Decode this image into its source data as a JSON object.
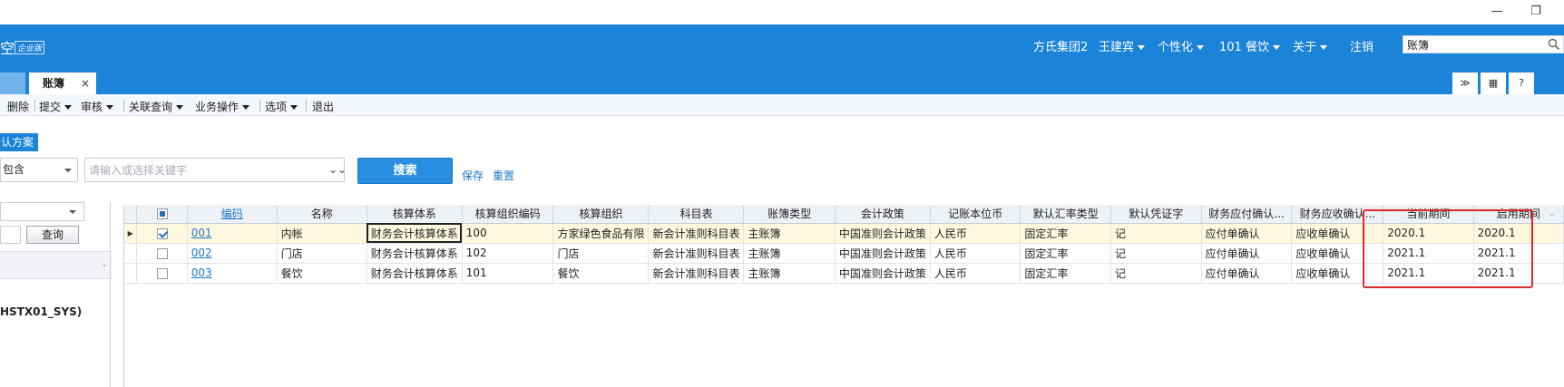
{
  "window": {
    "minimize": "—",
    "restore": "❐"
  },
  "header": {
    "logo_text": "空",
    "edition": "企业版",
    "org": "方氏集团2",
    "user": "王建宾",
    "personalize": "个性化",
    "company": "101  餐饮",
    "about": "关于",
    "logout": "注销",
    "search_value": "账簿"
  },
  "tabs": {
    "active_label": "账簿",
    "close": "×"
  },
  "tab_buttons": [
    "≫",
    "▦",
    "?"
  ],
  "toolbar": {
    "delete": "删除",
    "submit": "提交",
    "audit": "审核",
    "related_query": "关联查询",
    "business_ops": "业务操作",
    "options": "选项",
    "exit": "退出"
  },
  "query": {
    "scheme_label": "认方案",
    "condition_value": "包含",
    "keyword_placeholder": "请输入或选择关键字",
    "expand_icon": "⌄⌄",
    "search_button": "搜索",
    "save_link": "保存",
    "reset_link": "重置"
  },
  "left_panel": {
    "query_button": "查询",
    "node_label": "HSTX01_SYS)"
  },
  "table": {
    "columns": [
      "编码",
      "名称",
      "核算体系",
      "核算组织编码",
      "核算组织",
      "科目表",
      "账簿类型",
      "会计政策",
      "记账本位币",
      "默认汇率类型",
      "默认凭证字",
      "财务应付确认...",
      "财务应收确认...",
      "当前期间",
      "启用期间"
    ],
    "rows": [
      {
        "selected": true,
        "checked": true,
        "cells": [
          "001",
          "内帐",
          "财务会计核算体系",
          "100",
          "方家绿色食品有限",
          "新会计准则科目表",
          "主账簿",
          "中国准则会计政策",
          "人民币",
          "固定汇率",
          "记",
          "应付单确认",
          "应收单确认",
          "2020.1",
          "2020.1"
        ]
      },
      {
        "selected": false,
        "checked": false,
        "cells": [
          "002",
          "门店",
          "财务会计核算体系",
          "102",
          "门店",
          "新会计准则科目表",
          "主账簿",
          "中国准则会计政策",
          "人民币",
          "固定汇率",
          "记",
          "应付单确认",
          "应收单确认",
          "2021.1",
          "2021.1"
        ]
      },
      {
        "selected": false,
        "checked": false,
        "cells": [
          "003",
          "餐饮",
          "财务会计核算体系",
          "101",
          "餐饮",
          "新会计准则科目表",
          "主账簿",
          "中国准则会计政策",
          "人民币",
          "固定汇率",
          "记",
          "应付单确认",
          "应收单确认",
          "2021.1",
          "2021.1"
        ]
      }
    ]
  },
  "colors": {
    "brand_blue": "#1b83d8",
    "highlight_red": "#e02a2a",
    "selected_row": "#fff8de",
    "link": "#1a78c9"
  }
}
